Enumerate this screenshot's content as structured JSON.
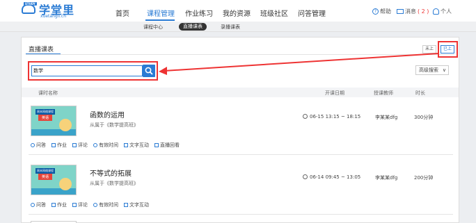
{
  "logo": {
    "badge": "STUDY",
    "title": "学堂里",
    "subtitle": "xuetangli.cn"
  },
  "nav": [
    {
      "label": "首页"
    },
    {
      "label": "课程管理"
    },
    {
      "label": "作业练习"
    },
    {
      "label": "我的资源"
    },
    {
      "label": "班级社区"
    },
    {
      "label": "问答管理"
    }
  ],
  "util": {
    "help": "帮助",
    "message": "消息",
    "message_count": "( 2 )",
    "personal": "个人"
  },
  "subnav": [
    {
      "label": "课程中心"
    },
    {
      "label": "直播课表"
    },
    {
      "label": "录播课表"
    }
  ],
  "panel": {
    "title": "直播课表",
    "toggle_not_started": "未上",
    "toggle_done": "已上",
    "search_value": "数学",
    "advanced_search": "高级搜索"
  },
  "table": {
    "headers": [
      "课时名称",
      "开课日期",
      "授课教师",
      "时长"
    ],
    "rows": [
      {
        "thumb_top": "周末网络课程",
        "thumb_sub": "英语",
        "title": "函数的运用",
        "from": "从属于《数学提高班》",
        "date": "06-15 13:15 ~ 18:15",
        "teacher": "李某某dfg",
        "duration": "300分钟",
        "actions": [
          "问答",
          "作业",
          "评论",
          "有效时间",
          "文字互动",
          "直播回看"
        ]
      },
      {
        "thumb_top": "周末网络课程",
        "thumb_sub": "英语",
        "title": "不等式的拓展",
        "from": "从属于《数学提高班》",
        "date": "06-14 09:45 ~ 13:05",
        "teacher": "李某某dfg",
        "duration": "200分钟",
        "actions": [
          "问答",
          "作业",
          "评论",
          "有效时间",
          "文字互动"
        ]
      }
    ]
  },
  "colors": {
    "accent": "#2a7bd4",
    "highlight": "#e33333"
  }
}
